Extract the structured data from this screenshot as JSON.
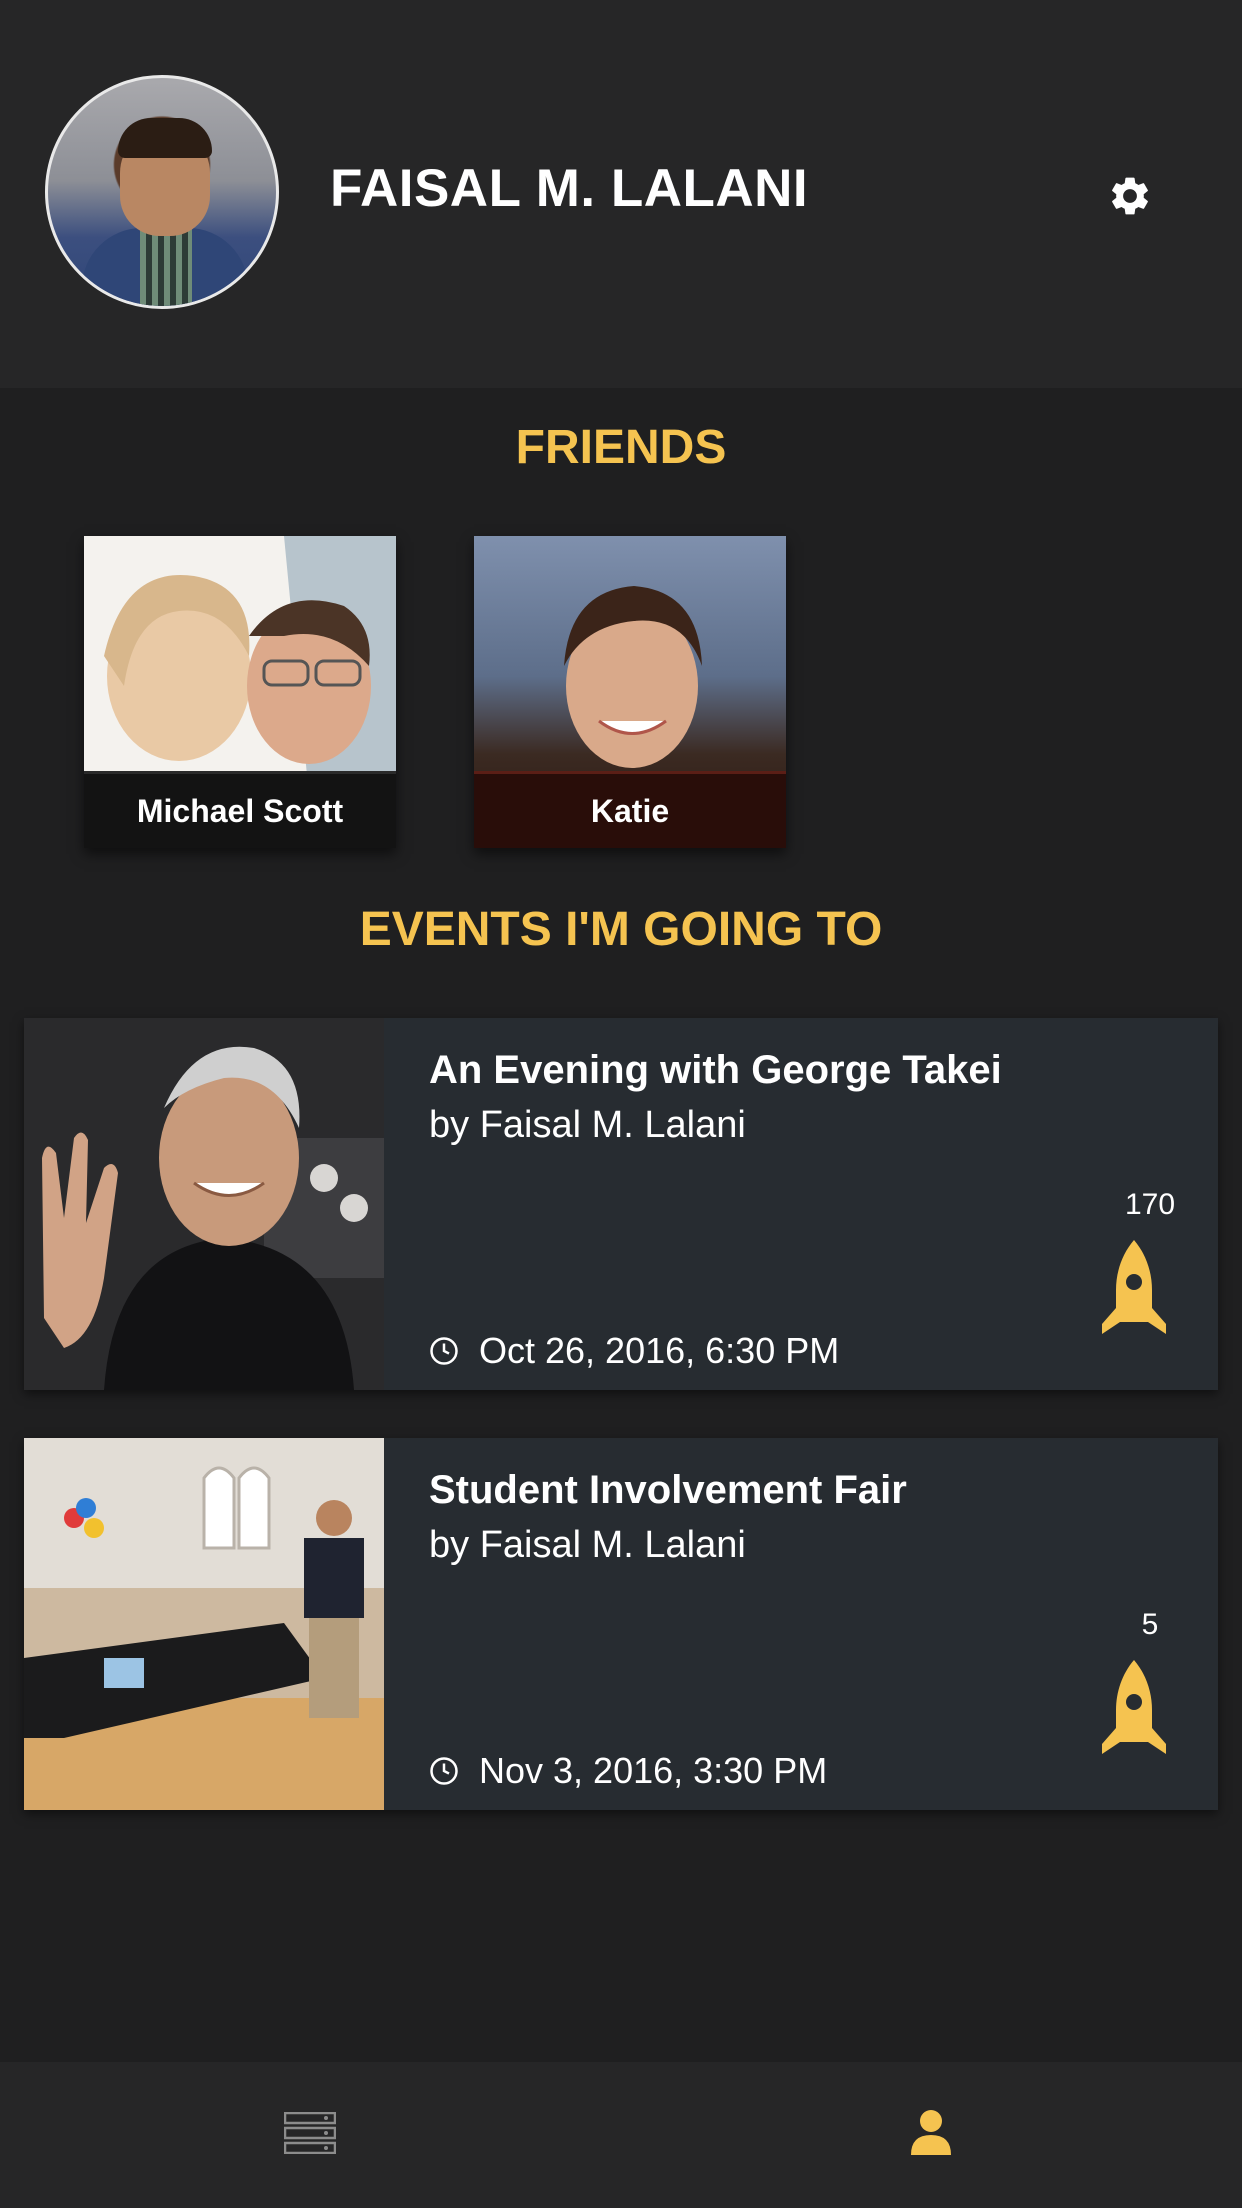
{
  "profile": {
    "name": "FAISAL M. LALANI"
  },
  "sections": {
    "friends_title": "FRIENDS",
    "events_title": "EVENTS I'M GOING TO"
  },
  "friends": [
    {
      "name": "Michael Scott"
    },
    {
      "name": "Katie"
    }
  ],
  "events": [
    {
      "title": "An Evening with George Takei",
      "author": "by Faisal M. Lalani",
      "date": "Oct 26, 2016, 6:30 PM",
      "count": "170"
    },
    {
      "title": "Student Involvement Fair",
      "author": "by Faisal M. Lalani",
      "date": "Nov 3, 2016, 3:30 PM",
      "count": "5"
    }
  ],
  "icons": {
    "settings": "gear-icon",
    "clock": "clock-icon",
    "rocket": "rocket-icon",
    "feed": "list-icon",
    "profile": "user-icon"
  },
  "colors": {
    "accent": "#f5c350",
    "background": "#1f1f20",
    "header": "#262627",
    "card": "#272c31",
    "nav_inactive": "#8c8c8c"
  }
}
